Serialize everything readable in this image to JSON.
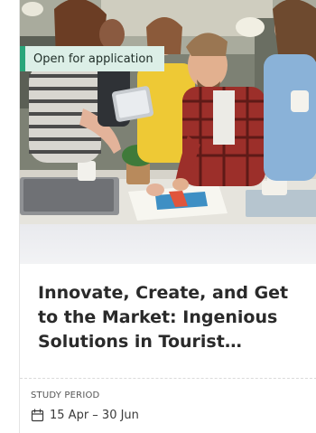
{
  "card": {
    "status_badge": "Open for application",
    "title": "Innovate, Create, and Get to the Market: Ingenious Solutions in Tourist…",
    "study_period_label": "STUDY PERIOD",
    "study_period_value": "15 Apr – 30 Jun",
    "icons": {
      "period": "calendar-icon"
    },
    "colors": {
      "badge_accent": "#2aa57a",
      "badge_background": "#dcefe7",
      "title_text": "#2a2a2a"
    }
  }
}
